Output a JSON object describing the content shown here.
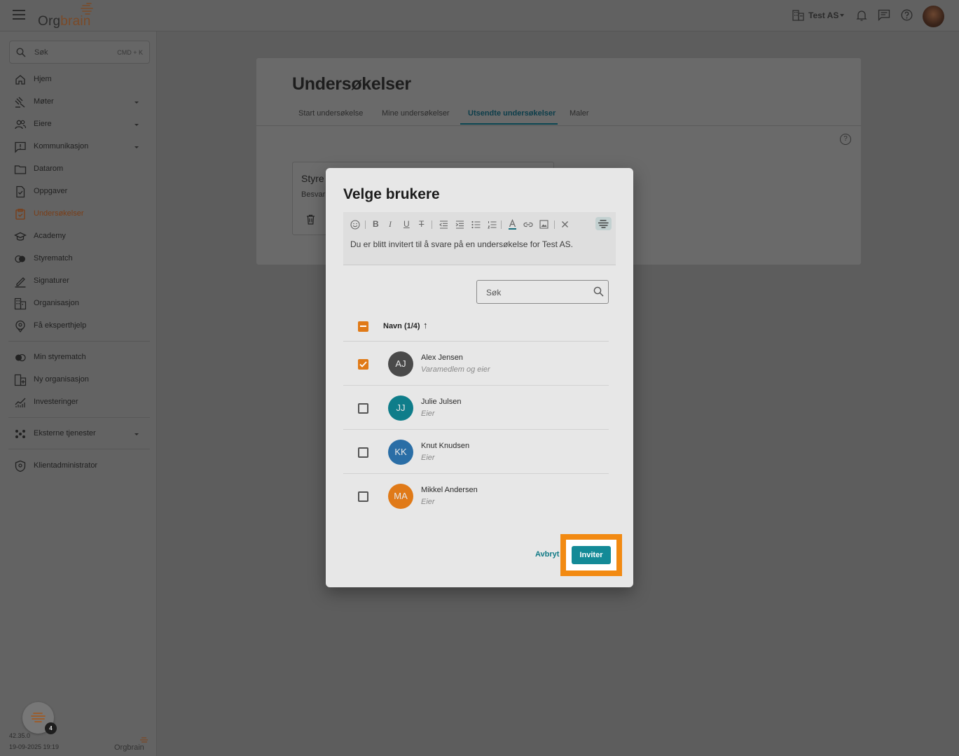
{
  "app": {
    "logo_prefix": "Org",
    "logo_accent": "brain",
    "org_name": "Test AS",
    "version": "42.35.0",
    "datetime": "19-09-2025 19:19",
    "footer_logo": "Orgbrain",
    "notification_count": "4"
  },
  "search": {
    "label": "Søk",
    "shortcut": "CMD + K"
  },
  "sidebar": {
    "items": [
      {
        "label": "Hjem",
        "icon": "home-icon"
      },
      {
        "label": "Møter",
        "icon": "gavel-icon",
        "expandable": true
      },
      {
        "label": "Eiere",
        "icon": "people-icon",
        "expandable": true
      },
      {
        "label": "Kommunikasjon",
        "icon": "message-icon",
        "expandable": true
      },
      {
        "label": "Datarom",
        "icon": "folder-icon"
      },
      {
        "label": "Oppgaver",
        "icon": "task-icon"
      },
      {
        "label": "Undersøkelser",
        "icon": "survey-icon",
        "active": true
      },
      {
        "label": "Academy",
        "icon": "graduation-cap-icon"
      },
      {
        "label": "Styrematch",
        "icon": "match-icon"
      },
      {
        "label": "Signaturer",
        "icon": "signature-icon"
      },
      {
        "label": "Organisasjon",
        "icon": "building-icon"
      },
      {
        "label": "Få eksperthjelp",
        "icon": "expert-icon"
      }
    ],
    "secondary": [
      {
        "label": "Min styrematch",
        "icon": "match-icon"
      },
      {
        "label": "Ny organisasjon",
        "icon": "building-add-icon"
      },
      {
        "label": "Investeringer",
        "icon": "chart-icon"
      }
    ],
    "external": {
      "label": "Eksterne tjenester",
      "icon": "apps-icon"
    },
    "admin": {
      "label": "Klientadministrator",
      "icon": "shield-icon"
    }
  },
  "page": {
    "title": "Undersøkelser",
    "tabs": [
      "Start undersøkelse",
      "Mine undersøkelser",
      "Utsendte undersøkelser",
      "Maler"
    ],
    "active_tab": 2,
    "card_title": "Styre",
    "card_sub": "Besvar"
  },
  "modal": {
    "title": "Velge brukere",
    "message": "Du er blitt invitert til å svare på en undersøkelse for Test AS.",
    "search_placeholder": "Søk",
    "column_header": "Navn (1/4)",
    "sort_arrow": "↑",
    "users": [
      {
        "initials": "AJ",
        "name": "Alex Jensen",
        "role": "Varamedlem og eier",
        "checked": true,
        "color": "#4a4a4a"
      },
      {
        "initials": "JJ",
        "name": "Julie Julsen",
        "role": "Eier",
        "checked": false,
        "color": "#0f7d8a"
      },
      {
        "initials": "KK",
        "name": "Knut Knudsen",
        "role": "Eier",
        "checked": false,
        "color": "#2a6ea6"
      },
      {
        "initials": "MA",
        "name": "Mikkel Andersen",
        "role": "Eier",
        "checked": false,
        "color": "#e07a18"
      }
    ],
    "cancel_label": "Avbryt",
    "invite_label": "Inviter"
  }
}
